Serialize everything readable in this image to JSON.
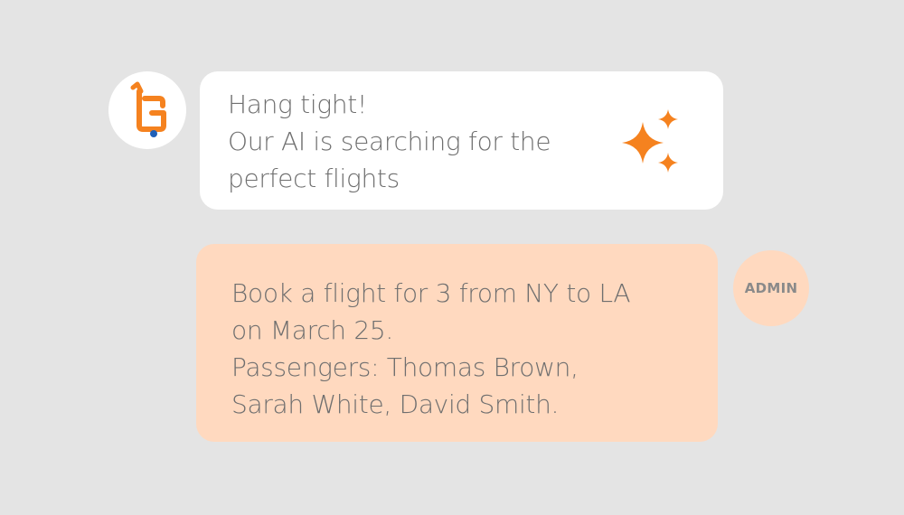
{
  "colors": {
    "background": "#e4e4e4",
    "bot_bubble": "#ffffff",
    "user_bubble": "#ffd9bf",
    "accent": "#f5821f",
    "dot": "#1f5fb7",
    "text": "#6f6f6f"
  },
  "bot_message": {
    "avatar_icon": "logo-g-icon",
    "lines": [
      "Hang tight!",
      "Our AI is searching for the",
      "perfect flights"
    ],
    "icon": "sparkles-icon"
  },
  "user_message": {
    "lines": [
      "Book a flight for 3 from NY to LA",
      "on March 25.",
      "Passengers: Thomas Brown,",
      "Sarah White, David Smith."
    ],
    "avatar_label": "ADMIN"
  }
}
